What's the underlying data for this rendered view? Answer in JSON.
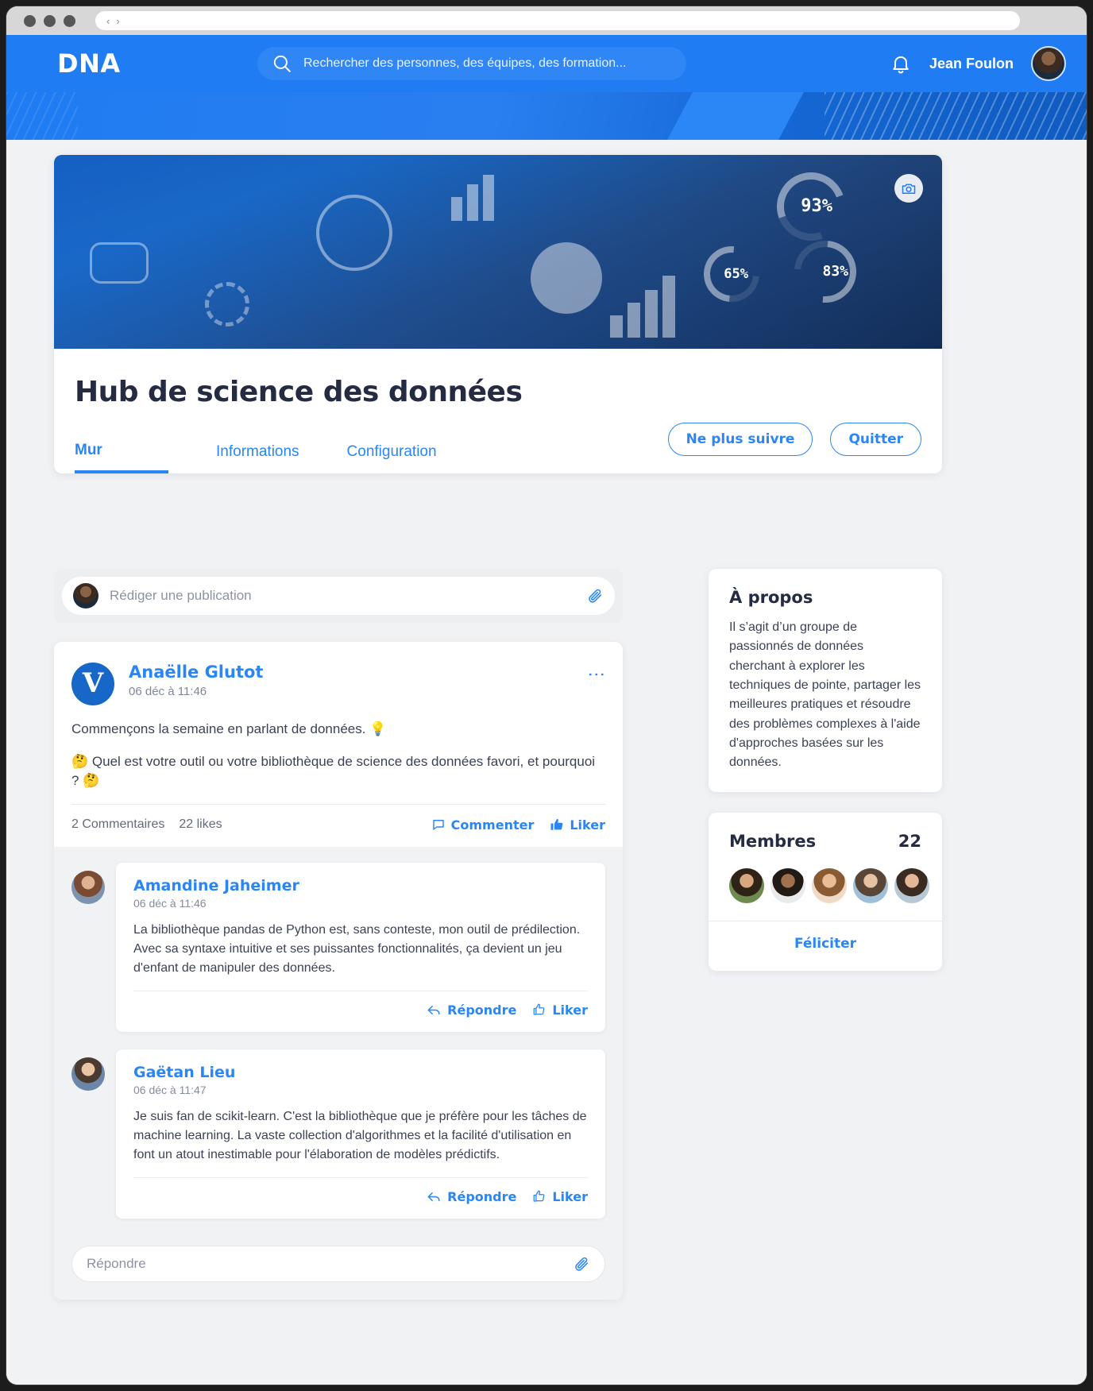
{
  "browser": {
    "back_arrow": "‹",
    "forward_arrow": "›",
    "url": ""
  },
  "header": {
    "brand": "DNA",
    "search": {
      "placeholder": "Rechercher des personnes, des équipes, des formation...",
      "value": "",
      "icon": "search-icon"
    },
    "notification_icon": "bell-icon",
    "user_name": "Jean Foulon",
    "avatar_icon": "user-avatar"
  },
  "group": {
    "title": "Hub de science des données",
    "cover_camera_icon": "camera-icon",
    "cover_labels": [
      "93%",
      "65%",
      "83%"
    ],
    "tabs": [
      {
        "label": "Mur",
        "active": true
      },
      {
        "label": "Informations",
        "active": false
      },
      {
        "label": "Configuration",
        "active": false
      }
    ],
    "actions": [
      {
        "label": "Ne plus suivre"
      },
      {
        "label": "Quitter"
      }
    ]
  },
  "compose": {
    "placeholder": "Rédiger une publication",
    "value": "",
    "attach_icon": "paperclip-icon"
  },
  "post": {
    "author": "Anaëlle Glutot",
    "logo_letter": "V",
    "timestamp": "06 déc à 11:46",
    "menu_icon": "kebab-menu-icon",
    "paragraphs": [
      "Commençons la semaine en parlant de données. 💡",
      "🤔 Quel est votre outil ou votre bibliothèque de science des données favori, et pourquoi ? 🤔"
    ],
    "comments_count": "2 Commentaires",
    "likes_count": "22 likes",
    "comment_action": "Commenter",
    "like_action": "Liker",
    "comment_icon": "comment-bubble-icon",
    "like_icon": "thumbs-up-icon"
  },
  "comments": [
    {
      "author": "Amandine Jaheimer",
      "timestamp": "06 déc à 11:46",
      "text": "La bibliothèque pandas de Python est, sans conteste, mon outil de prédilection. Avec sa syntaxe intuitive et ses puissantes fonctionnalités, ça devient un jeu d'enfant de manipuler des données.",
      "reply_action": "Répondre",
      "like_action": "Liker"
    },
    {
      "author": "Gaëtan Lieu",
      "timestamp": "06 déc à 11:47",
      "text": "Je suis fan de scikit-learn. C'est la bibliothèque que je préfère pour les tâches de machine learning. La vaste collection d'algorithmes et la facilité d'utilisation en font un atout inestimable pour l'élaboration de modèles prédictifs.",
      "reply_action": "Répondre",
      "like_action": "Liker"
    }
  ],
  "reply_box": {
    "placeholder": "Répondre",
    "value": "",
    "attach_icon": "paperclip-icon"
  },
  "sidebar": {
    "about": {
      "title": "À propos",
      "text": "Il s’agit d’un groupe de passionnés de données cherchant à explorer les techniques de pointe, partager les meilleures pratiques et résoudre des problèmes complexes à l'aide d'approches basées sur les données."
    },
    "members": {
      "title": "Membres",
      "count": "22",
      "felicitate_label": "Féliciter",
      "avatar_count": 5
    }
  },
  "colors": {
    "brand_blue": "#1f7cf2",
    "link_blue": "#2a86f5",
    "text_dark": "#242b42",
    "body_text": "#3b4256",
    "page_bg": "#f1f2f4"
  }
}
